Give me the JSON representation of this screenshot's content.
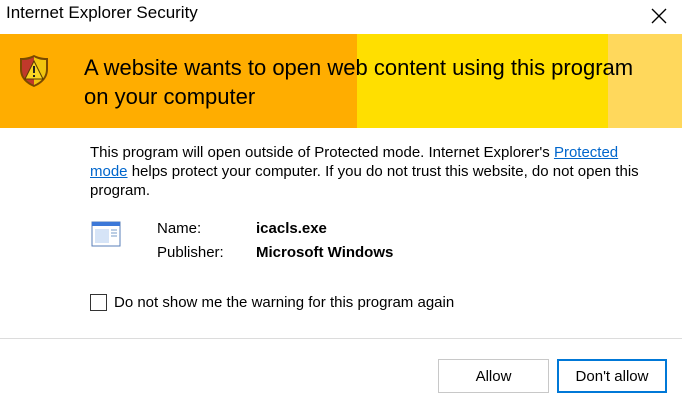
{
  "window": {
    "title": "Internet Explorer Security",
    "close_icon": "close-icon"
  },
  "banner": {
    "icon": "warning-shield-icon",
    "headline": "A website wants to open web content using this program on your computer",
    "colors": {
      "left": "#ffad00",
      "middle": "#ffdf00",
      "right": "#ffd85c"
    }
  },
  "message": {
    "part1": "This program will open outside of Protected mode. Internet Explorer's ",
    "link": "Protected mode",
    "part2": " helps protect your computer. If you do not trust this website, do not open this program."
  },
  "program": {
    "icon": "program-window-icon",
    "name_label": "Name:",
    "name_value": "icacls.exe",
    "publisher_label": "Publisher:",
    "publisher_value": "Microsoft Windows"
  },
  "checkbox": {
    "label": "Do not show me the warning for this program again",
    "checked": false
  },
  "buttons": {
    "allow": "Allow",
    "deny": "Don't allow"
  }
}
